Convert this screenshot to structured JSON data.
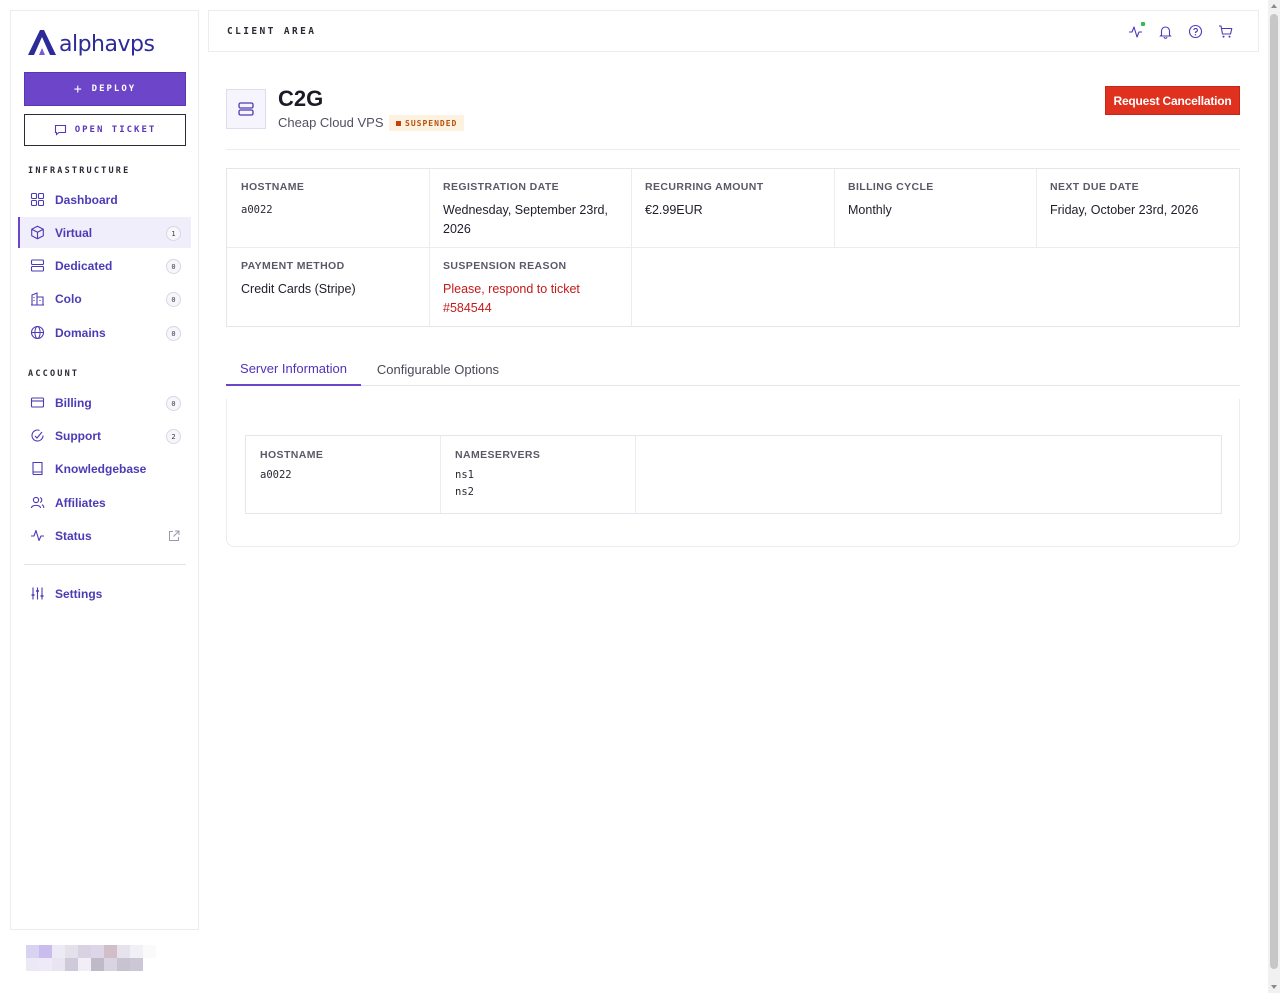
{
  "brand": {
    "name": "alphavps"
  },
  "sidebar": {
    "deploy_label": "DEPLOY",
    "open_ticket_label": "OPEN TICKET",
    "infrastructure_label": "INFRASTRUCTURE",
    "account_label": "ACCOUNT",
    "infrastructure": [
      {
        "label": "Dashboard",
        "icon": "grid-icon"
      },
      {
        "label": "Virtual",
        "icon": "cube-icon",
        "count": "1",
        "active": true
      },
      {
        "label": "Dedicated",
        "icon": "server-icon",
        "count": "0"
      },
      {
        "label": "Colo",
        "icon": "building-icon",
        "count": "0"
      },
      {
        "label": "Domains",
        "icon": "globe-icon",
        "count": "0"
      }
    ],
    "account": [
      {
        "label": "Billing",
        "icon": "credit-card-icon",
        "count": "0"
      },
      {
        "label": "Support",
        "icon": "support-icon",
        "count": "2"
      },
      {
        "label": "Knowledgebase",
        "icon": "book-icon"
      },
      {
        "label": "Affiliates",
        "icon": "users-icon"
      },
      {
        "label": "Status",
        "icon": "activity-icon"
      }
    ],
    "settings_label": "Settings"
  },
  "header": {
    "title": "CLIENT AREA"
  },
  "product": {
    "name": "C2G",
    "subtitle": "Cheap Cloud VPS",
    "status": "SUSPENDED",
    "cancel_label": "Request Cancellation"
  },
  "details": {
    "hostname_label": "HOSTNAME",
    "hostname": "a0022",
    "registration_label": "REGISTRATION DATE",
    "registration": "Wednesday, September 23rd, 2026",
    "recurring_label": "RECURRING AMOUNT",
    "recurring": "€2.99EUR",
    "billing_cycle_label": "BILLING CYCLE",
    "billing_cycle": "Monthly",
    "next_due_label": "NEXT DUE DATE",
    "next_due": "Friday, October 23rd, 2026",
    "payment_method_label": "PAYMENT METHOD",
    "payment_method": "Credit Cards (Stripe)",
    "suspension_label": "SUSPENSION REASON",
    "suspension_reason": "Please, respond to ticket #584544"
  },
  "tabs": [
    {
      "label": "Server Information",
      "active": true
    },
    {
      "label": "Configurable Options",
      "active": false
    }
  ],
  "server_info": {
    "hostname_label": "HOSTNAME",
    "hostname": "a0022",
    "nameservers_label": "NAMESERVERS",
    "ns1": "ns1",
    "ns2": "ns2"
  },
  "colors": {
    "accent": "#6c45c8",
    "danger": "#e0301e",
    "status_suspended": "#b4530f"
  }
}
